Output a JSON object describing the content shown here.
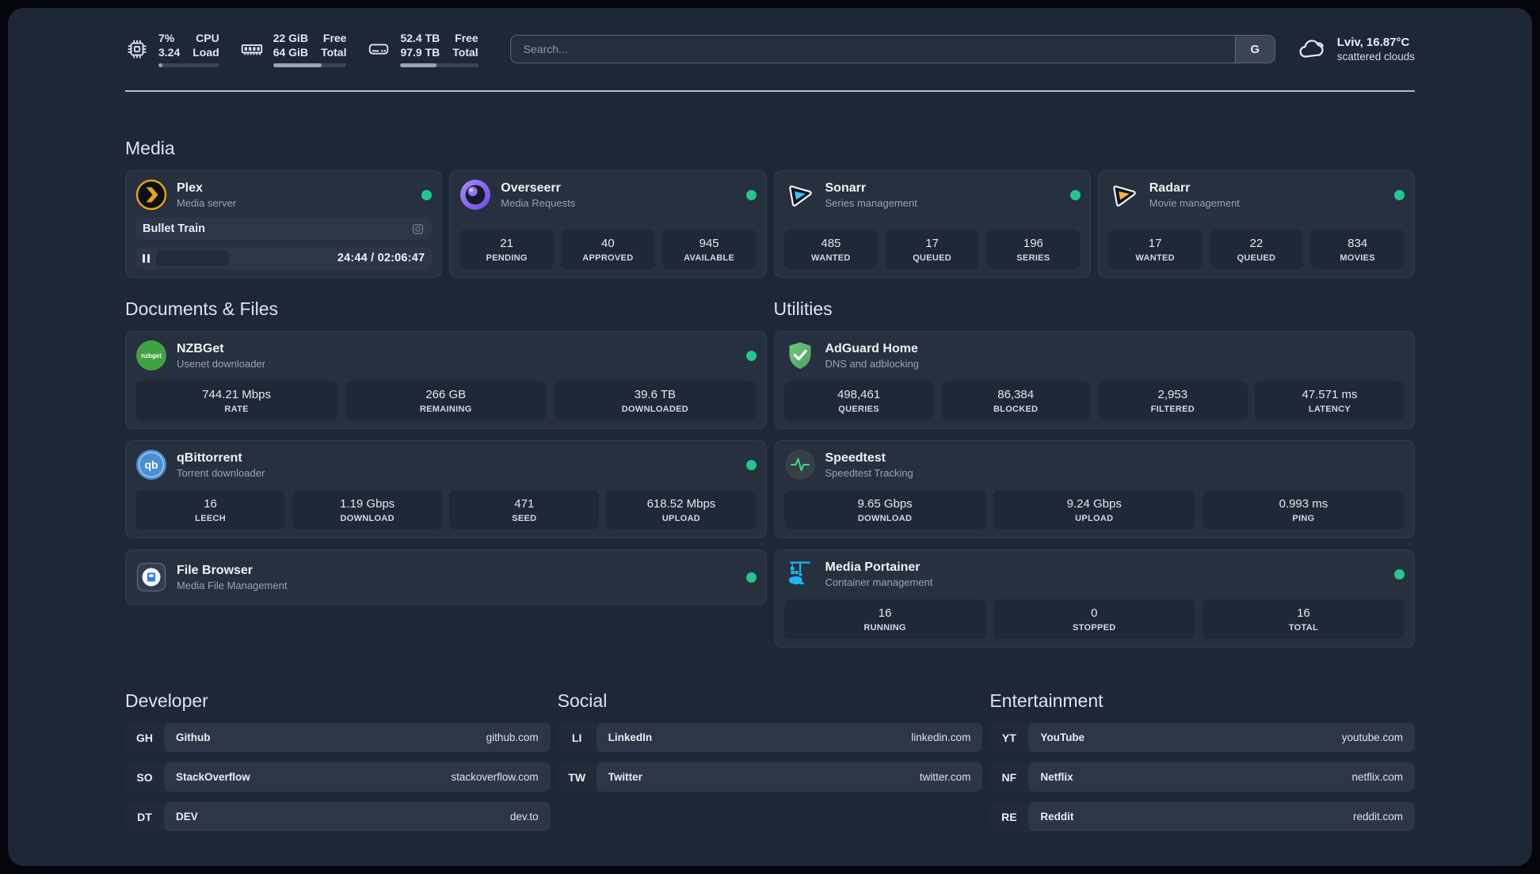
{
  "topbar": {
    "cpu": {
      "values": [
        "7%",
        "3.24"
      ],
      "labels": [
        "CPU",
        "Load"
      ],
      "progress": 7
    },
    "memory": {
      "values": [
        "22 GiB",
        "64 GiB"
      ],
      "labels": [
        "Free",
        "Total"
      ],
      "progress": 66
    },
    "disk": {
      "values": [
        "52.4 TB",
        "97.9 TB"
      ],
      "labels": [
        "Free",
        "Total"
      ],
      "progress": 46
    },
    "search": {
      "placeholder": "Search...",
      "button_label": "G"
    },
    "weather": {
      "location": "Lviv, 16.87°C",
      "condition": "scattered clouds"
    }
  },
  "media": {
    "title": "Media",
    "plex": {
      "name": "Plex",
      "desc": "Media server",
      "now_playing": "Bullet Train",
      "time": "24:44 / 02:06:47"
    },
    "overseerr": {
      "name": "Overseerr",
      "desc": "Media Requests",
      "stats": [
        {
          "value": "21",
          "label": "PENDING"
        },
        {
          "value": "40",
          "label": "APPROVED"
        },
        {
          "value": "945",
          "label": "AVAILABLE"
        }
      ]
    },
    "sonarr": {
      "name": "Sonarr",
      "desc": "Series management",
      "stats": [
        {
          "value": "485",
          "label": "WANTED"
        },
        {
          "value": "17",
          "label": "QUEUED"
        },
        {
          "value": "196",
          "label": "SERIES"
        }
      ]
    },
    "radarr": {
      "name": "Radarr",
      "desc": "Movie management",
      "stats": [
        {
          "value": "17",
          "label": "WANTED"
        },
        {
          "value": "22",
          "label": "QUEUED"
        },
        {
          "value": "834",
          "label": "MOVIES"
        }
      ]
    }
  },
  "documents": {
    "title": "Documents & Files",
    "nzbget": {
      "name": "NZBGet",
      "desc": "Usenet downloader",
      "stats": [
        {
          "value": "744.21 Mbps",
          "label": "RATE"
        },
        {
          "value": "266 GB",
          "label": "REMAINING"
        },
        {
          "value": "39.6 TB",
          "label": "DOWNLOADED"
        }
      ]
    },
    "qbittorrent": {
      "name": "qBittorrent",
      "desc": "Torrent downloader",
      "stats": [
        {
          "value": "16",
          "label": "LEECH"
        },
        {
          "value": "1.19 Gbps",
          "label": "DOWNLOAD"
        },
        {
          "value": "471",
          "label": "SEED"
        },
        {
          "value": "618.52 Mbps",
          "label": "UPLOAD"
        }
      ]
    },
    "filebrowser": {
      "name": "File Browser",
      "desc": "Media File Management"
    }
  },
  "utilities": {
    "title": "Utilities",
    "adguard": {
      "name": "AdGuard Home",
      "desc": "DNS and adblocking",
      "stats": [
        {
          "value": "498,461",
          "label": "QUERIES"
        },
        {
          "value": "86,384",
          "label": "BLOCKED"
        },
        {
          "value": "2,953",
          "label": "FILTERED"
        },
        {
          "value": "47.571 ms",
          "label": "LATENCY"
        }
      ]
    },
    "speedtest": {
      "name": "Speedtest",
      "desc": "Speedtest Tracking",
      "stats": [
        {
          "value": "9.65 Gbps",
          "label": "DOWNLOAD"
        },
        {
          "value": "9.24 Gbps",
          "label": "UPLOAD"
        },
        {
          "value": "0.993 ms",
          "label": "PING"
        }
      ]
    },
    "portainer": {
      "name": "Media Portainer",
      "desc": "Container management",
      "stats": [
        {
          "value": "16",
          "label": "RUNNING"
        },
        {
          "value": "0",
          "label": "STOPPED"
        },
        {
          "value": "16",
          "label": "TOTAL"
        }
      ]
    }
  },
  "bookmarks": {
    "developer": {
      "title": "Developer",
      "links": [
        {
          "abbr": "GH",
          "name": "Github",
          "url": "github.com"
        },
        {
          "abbr": "SO",
          "name": "StackOverflow",
          "url": "stackoverflow.com"
        },
        {
          "abbr": "DT",
          "name": "DEV",
          "url": "dev.to"
        }
      ]
    },
    "social": {
      "title": "Social",
      "links": [
        {
          "abbr": "LI",
          "name": "LinkedIn",
          "url": "linkedin.com"
        },
        {
          "abbr": "TW",
          "name": "Twitter",
          "url": "twitter.com"
        }
      ]
    },
    "entertainment": {
      "title": "Entertainment",
      "links": [
        {
          "abbr": "YT",
          "name": "YouTube",
          "url": "youtube.com"
        },
        {
          "abbr": "NF",
          "name": "Netflix",
          "url": "netflix.com"
        },
        {
          "abbr": "RE",
          "name": "Reddit",
          "url": "reddit.com"
        }
      ]
    }
  },
  "icons": {
    "nzbget_label": "nzbget",
    "qbittorrent_label": "qb",
    "names": [
      "cpu-icon",
      "memory-icon",
      "disk-icon",
      "google-icon",
      "cloud-icon",
      "plex-icon",
      "overseerr-icon",
      "sonarr-icon",
      "radarr-icon",
      "nzbget-icon",
      "qbittorrent-icon",
      "filebrowser-icon",
      "adguard-icon",
      "speedtest-icon",
      "portainer-icon",
      "video-camera-icon",
      "pause-icon",
      "status-dot"
    ]
  },
  "colors": {
    "status_online": "#22c78e",
    "background": "#1d2737",
    "card": "#27303e",
    "plex_gold": "#e7a513",
    "sonarr_cyan": "#35c5f4",
    "radarr_amber": "#ffb43a"
  }
}
